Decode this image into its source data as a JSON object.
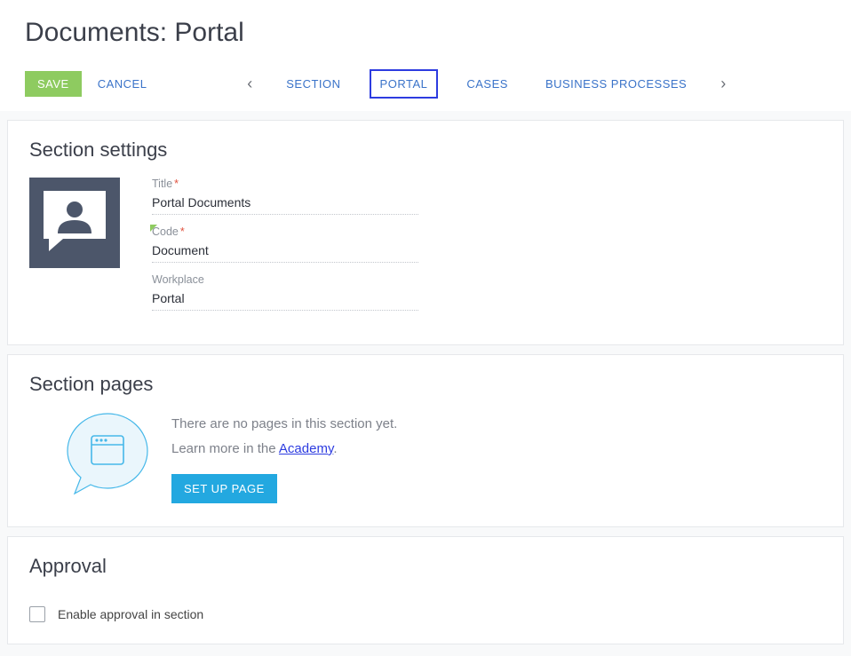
{
  "page": {
    "title": "Documents: Portal"
  },
  "toolbar": {
    "save": "SAVE",
    "cancel": "CANCEL"
  },
  "tabs": {
    "prev": "‹",
    "next": "›",
    "items": [
      {
        "label": "SECTION"
      },
      {
        "label": "PORTAL",
        "active": true
      },
      {
        "label": "CASES"
      },
      {
        "label": "BUSINESS PROCESSES"
      }
    ]
  },
  "section_settings": {
    "heading": "Section settings",
    "icon": "person-chat-icon",
    "fields": {
      "title": {
        "label": "Title",
        "value": "Portal Documents",
        "required": true
      },
      "code": {
        "label": "Code",
        "value": "Document",
        "required": true,
        "marker": true
      },
      "workplace": {
        "label": "Workplace",
        "value": "Portal"
      }
    }
  },
  "section_pages": {
    "heading": "Section pages",
    "empty_line": "There are no pages in this section yet.",
    "learn_prefix": "Learn more in the ",
    "academy_label": "Academy",
    "learn_suffix": ".",
    "setup_button": "SET UP PAGE"
  },
  "approval": {
    "heading": "Approval",
    "checkbox_label": "Enable approval in section",
    "checked": false
  }
}
